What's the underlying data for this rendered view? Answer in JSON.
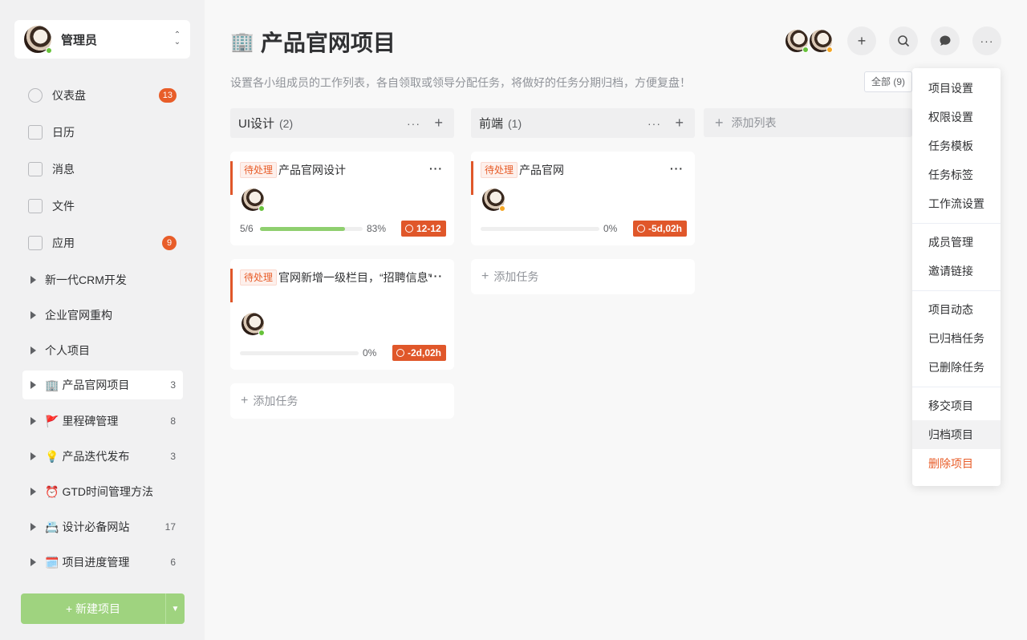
{
  "user": {
    "name": "管理员"
  },
  "nav": [
    {
      "label": "仪表盘",
      "badge": "13",
      "icon": "dashboard-icon"
    },
    {
      "label": "日历",
      "badge": null,
      "icon": "calendar-icon"
    },
    {
      "label": "消息",
      "badge": null,
      "icon": "message-icon"
    },
    {
      "label": "文件",
      "badge": null,
      "icon": "file-icon"
    },
    {
      "label": "应用",
      "badge": "9",
      "icon": "apps-icon"
    }
  ],
  "projects": [
    {
      "emoji": "",
      "label": "新一代CRM开发",
      "count": ""
    },
    {
      "emoji": "",
      "label": "企业官网重构",
      "count": ""
    },
    {
      "emoji": "",
      "label": "个人项目",
      "count": ""
    },
    {
      "emoji": "🏢",
      "label": "产品官网项目",
      "count": "3"
    },
    {
      "emoji": "🚩",
      "label": "里程碑管理",
      "count": "8"
    },
    {
      "emoji": "💡",
      "label": "产品迭代发布",
      "count": "3"
    },
    {
      "emoji": "⏰",
      "label": "GTD时间管理方法",
      "count": ""
    },
    {
      "emoji": "📇",
      "label": "设计必备网站",
      "count": "17"
    },
    {
      "emoji": "🗓️",
      "label": "项目进度管理",
      "count": "6"
    }
  ],
  "new_project_label": "+ 新建项目",
  "page": {
    "emoji": "🏢",
    "title": "产品官网项目",
    "subtitle": "设置各小组成员的工作列表，各自领取或领导分配任务，将做好的任务分期归档，方便复盘！",
    "filter": "全部 (9)"
  },
  "columns": [
    {
      "name": "UI设计",
      "count": "(2)"
    },
    {
      "name": "前端",
      "count": "(1)"
    }
  ],
  "add_column_label": "添加列表",
  "cards": [
    {
      "tag": "待处理",
      "title": "产品官网设计",
      "progress_text": "5/6",
      "progress": 0.83,
      "percent": "83%",
      "deadline": "12-12"
    },
    {
      "tag": "待处理",
      "title": "官网新增一级栏目，“招聘信息”",
      "progress_text": "",
      "progress": 0,
      "percent": "0%",
      "deadline": "-2d,02h"
    },
    {
      "tag": "待处理",
      "title": "产品官网",
      "progress_text": "",
      "progress": 0,
      "percent": "0%",
      "deadline": "-5d,02h"
    }
  ],
  "add_task_label": "添加任务",
  "menu": [
    "项目设置",
    "权限设置",
    "任务模板",
    "任务标签",
    "工作流设置",
    "成员管理",
    "邀请链接",
    "项目动态",
    "已归档任务",
    "已删除任务",
    "移交项目",
    "归档项目",
    "删除项目"
  ],
  "colors": {
    "accent": "#e85d29",
    "progress": "#8fcf6f",
    "new_button": "#9fd37f"
  }
}
